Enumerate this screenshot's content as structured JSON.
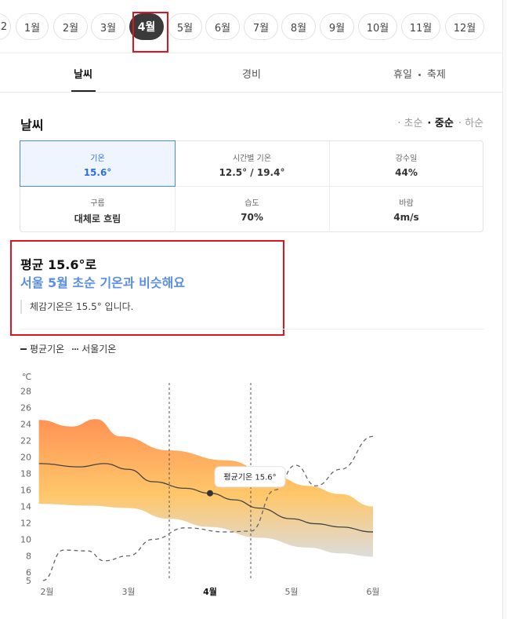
{
  "months": [
    "1월",
    "2월",
    "3월",
    "4월",
    "5월",
    "6월",
    "7월",
    "8월",
    "9월",
    "10월",
    "11월",
    "12월"
  ],
  "active_month": "4월",
  "tabs": [
    {
      "label": "날씨"
    },
    {
      "label": "경비"
    },
    {
      "label_a": "휴일",
      "label_b": "축제"
    }
  ],
  "weather": {
    "title": "날씨",
    "periods": [
      "초순",
      "중순",
      "하순"
    ],
    "selected_period": "중순"
  },
  "stats": [
    {
      "label": "기온",
      "value": "15.6°"
    },
    {
      "label": "시간별 기온",
      "value": "12.5° / 19.4°"
    },
    {
      "label": "강수일",
      "value": "44%"
    },
    {
      "label": "구름",
      "value": "대체로 흐림"
    },
    {
      "label": "습도",
      "value": "70%"
    },
    {
      "label": "바람",
      "value": "4m/s"
    }
  ],
  "summary": {
    "line1": "평균 15.6°로",
    "line2": "서울 5월 초순 기온과 비슷해요",
    "feel": "체감기온은 15.5° 입니다."
  },
  "legend": {
    "avg": "평균기온",
    "seoul": "서울기온"
  },
  "colors": {
    "accent": "#2d6fe0",
    "highlight_text": "#5a8ee8",
    "band_top": "#ff9a5c",
    "band_bottom": "#d9d9d9",
    "mark": "#e0141e"
  },
  "chart_data": {
    "type": "area",
    "ylabel": "℃",
    "y_ticks": [
      5,
      6,
      8,
      10,
      12,
      14,
      16,
      18,
      20,
      22,
      24,
      26,
      28
    ],
    "ylim": [
      5,
      29
    ],
    "x_labels": [
      "2월",
      "3월",
      "4월",
      "5월",
      "6월"
    ],
    "x_positions": [
      0,
      1,
      2,
      3,
      4
    ],
    "current_x": 2,
    "tooltip": "평균기온 15.6°",
    "band_upper": [
      [
        -0.1,
        24.5
      ],
      [
        0.3,
        23.7
      ],
      [
        0.6,
        24.6
      ],
      [
        0.9,
        22.5
      ],
      [
        1.5,
        20.8
      ],
      [
        2.2,
        19.6
      ],
      [
        2.8,
        17.6
      ],
      [
        3.2,
        16.5
      ],
      [
        3.6,
        15.5
      ],
      [
        4.0,
        14.0
      ]
    ],
    "band_lower": [
      [
        -0.1,
        14.3
      ],
      [
        0.5,
        14.1
      ],
      [
        1.0,
        13.8
      ],
      [
        1.5,
        12.5
      ],
      [
        2.0,
        11.5
      ],
      [
        2.6,
        10.2
      ],
      [
        3.2,
        9.0
      ],
      [
        3.6,
        8.3
      ],
      [
        4.0,
        7.9
      ]
    ],
    "series": [
      {
        "name": "평균기온",
        "values": [
          [
            -0.1,
            19.2
          ],
          [
            0.4,
            18.8
          ],
          [
            0.7,
            19.2
          ],
          [
            1.0,
            18.5
          ],
          [
            1.3,
            17.0
          ],
          [
            1.7,
            16.2
          ],
          [
            2.0,
            15.6
          ],
          [
            2.3,
            14.8
          ],
          [
            2.6,
            13.8
          ],
          [
            3.0,
            12.5
          ],
          [
            3.3,
            11.9
          ],
          [
            3.6,
            11.5
          ],
          [
            4.0,
            10.9
          ]
        ]
      },
      {
        "name": "서울기온",
        "values": [
          [
            -0.05,
            5.0
          ],
          [
            0.2,
            8.7
          ],
          [
            0.5,
            8.6
          ],
          [
            0.7,
            7.4
          ],
          [
            1.0,
            8.0
          ],
          [
            1.3,
            10.0
          ],
          [
            1.7,
            11.4
          ],
          [
            2.2,
            10.9
          ],
          [
            2.5,
            11.0
          ],
          [
            2.8,
            16.0
          ],
          [
            3.05,
            19.0
          ],
          [
            3.3,
            16.5
          ],
          [
            3.6,
            18.5
          ],
          [
            4.0,
            22.5
          ]
        ]
      }
    ],
    "period_lines_x": [
      1.5,
      2.5
    ]
  }
}
